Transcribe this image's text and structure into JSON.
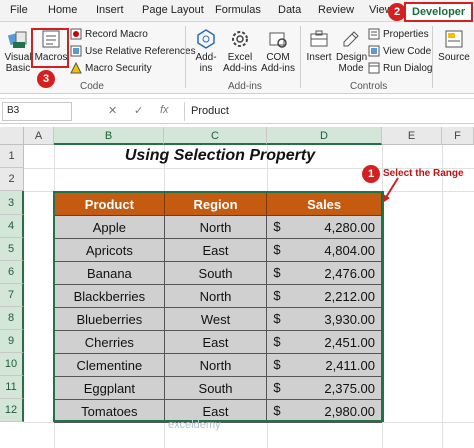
{
  "ribbon_tabs": [
    "File",
    "Home",
    "Insert",
    "Page Layout",
    "Formulas",
    "Data",
    "Review",
    "View",
    "Developer"
  ],
  "active_tab": "Developer",
  "code_group": {
    "visual_basic": "Visual\nBasic",
    "macros": "Macros",
    "record_macro": "Record Macro",
    "use_relative": "Use Relative References",
    "macro_security": "Macro Security",
    "label": "Code"
  },
  "addins_group": {
    "addins": "Add-\nins",
    "excel_addins": "Excel\nAdd-ins",
    "com_addins": "COM\nAdd-ins",
    "label": "Add-ins"
  },
  "controls_group": {
    "insert": "Insert",
    "design_mode": "Design\nMode",
    "properties": "Properties",
    "view_code": "View Code",
    "run_dialog": "Run Dialog",
    "source": "Source",
    "label": "Controls"
  },
  "badges": {
    "one": "1",
    "two": "2",
    "three": "3"
  },
  "formula_bar": {
    "name_box": "B3",
    "cancel": "✕",
    "enter": "✓",
    "fx": "fx",
    "content": "Product"
  },
  "columns": [
    "A",
    "B",
    "C",
    "D",
    "E",
    "F"
  ],
  "rows": [
    "1",
    "2",
    "3",
    "4",
    "5",
    "6",
    "7",
    "8",
    "9",
    "10",
    "11",
    "12"
  ],
  "sheet_title": "Using Selection Property",
  "annotation": "Select the Range",
  "table": {
    "headers": [
      "Product",
      "Region",
      "Sales"
    ],
    "currency": "$",
    "rows": [
      [
        "Apple",
        "North",
        "4,280.00"
      ],
      [
        "Apricots",
        "East",
        "4,804.00"
      ],
      [
        "Banana",
        "South",
        "2,476.00"
      ],
      [
        "Blackberries",
        "North",
        "2,212.00"
      ],
      [
        "Blueberries",
        "West",
        "3,930.00"
      ],
      [
        "Cherries",
        "East",
        "2,451.00"
      ],
      [
        "Clementine",
        "North",
        "2,411.00"
      ],
      [
        "Eggplant",
        "South",
        "2,375.00"
      ],
      [
        "Tomatoes",
        "East",
        "2,980.00"
      ]
    ]
  },
  "watermark": "exceldemy",
  "colors": {
    "excel_green": "#217346",
    "header_orange": "#c55a11",
    "highlight_red": "#d02020",
    "cell_gray": "#d0d0d0"
  }
}
